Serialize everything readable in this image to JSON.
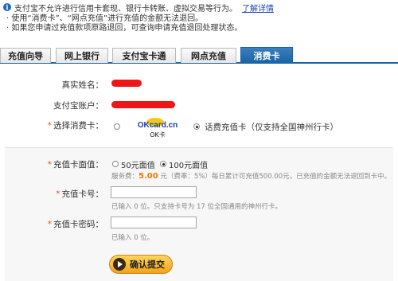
{
  "notice": {
    "text": "支付宝不允许进行信用卡套现、银行卡转账、虚拟交易等行为。",
    "link": "了解详情"
  },
  "tips": [
    "· 使用“消费卡”、“网点充值”进行充值的金额无法退回。",
    "· 如果您申请过充值款项原路退回，可查询申请充值退回处理状态。"
  ],
  "tabs": [
    {
      "label": "充值向导"
    },
    {
      "label": "网上银行"
    },
    {
      "label": "支付宝卡通"
    },
    {
      "label": "网点充值"
    },
    {
      "label": "消费卡",
      "active": true
    }
  ],
  "form": {
    "real_name_label": "真实姓名：",
    "account_label": "支付宝账户：",
    "card_select_label": "选择消费卡：",
    "okcard_brand": "OKcard.cn",
    "okcard_sub": "OK卡",
    "phone_card_option": "话费充值卡（仅支持全国神州行卡）",
    "face_value_label": "充值卡面值：",
    "face_value_options": [
      "50元面值",
      "100元面值"
    ],
    "selected_face_value": "100元面值",
    "fee_prefix": "服务费：",
    "fee_amount": "5.00",
    "fee_suffix": " 元（费率：5%）每日累计可充值500.00元，已充值的金额无法退回到卡中。",
    "card_no_label": "充值卡号：",
    "card_no_value": "",
    "card_no_hint": "已输入 0 位。只支持卡号为 17 位全国通用的神州行卡。",
    "card_pwd_label": "充值卡密码：",
    "card_pwd_value": "",
    "card_pwd_hint": "已输入 0 位。",
    "submit_label": "确认提交"
  }
}
